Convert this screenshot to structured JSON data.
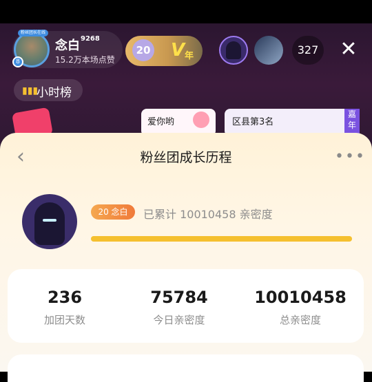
{
  "header": {
    "host_name": "念白",
    "host_badge_num": "9268",
    "host_likes": "15.2万本场点赞",
    "host_avatar_label": "粉丝团长在线",
    "host_level": "8",
    "fan_level": "20",
    "v_badge": "V",
    "v_year": "年",
    "viewer_count": "327"
  },
  "live": {
    "rank_label": "小时榜",
    "banner1": "爱你哟",
    "banner2": "区县第3名",
    "banner2_tag": "嘉年"
  },
  "sheet": {
    "title": "粉丝团成长历程",
    "fan_badge": "20 念白",
    "intimacy_text": "已累计 10010458 亲密度",
    "progress": 1.0,
    "stats": [
      {
        "value": "236",
        "label": "加团天数"
      },
      {
        "value": "75784",
        "label": "今日亲密度"
      },
      {
        "value": "10010458",
        "label": "总亲密度"
      }
    ]
  },
  "colors": {
    "accent": "#f5c02f",
    "sheet_bg": "#fff2d8"
  }
}
